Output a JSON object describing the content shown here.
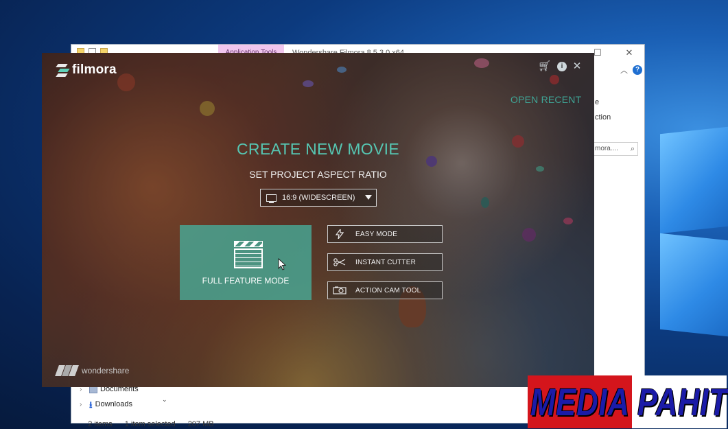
{
  "explorer": {
    "app_tools_tab": "Application Tools",
    "title": "Wondershare Filmora 8.5.3.0 x64",
    "ribbon_text_1": "e",
    "ribbon_text_2": "ction",
    "search_value": "mora....",
    "tree_items": [
      {
        "label": "Documents"
      },
      {
        "label": "Downloads"
      }
    ],
    "status": {
      "items": "2 items",
      "selected": "1 item selected",
      "size": "207 MB"
    }
  },
  "filmora": {
    "brand": "filmora",
    "open_recent": "OPEN RECENT",
    "create_title": "CREATE NEW MOVIE",
    "aspect_label": "SET PROJECT ASPECT RATIO",
    "aspect_value": "16:9  (WIDESCREEN)",
    "full_feature_label": "FULL FEATURE MODE",
    "modes": [
      {
        "label": "EASY MODE",
        "icon": "lightning-icon"
      },
      {
        "label": "INSTANT CUTTER",
        "icon": "scissors-icon"
      },
      {
        "label": "ACTION CAM TOOL",
        "icon": "camera-icon"
      }
    ],
    "footer_brand": "wondershare"
  },
  "watermark": {
    "text": "MEDIA PAHIT"
  },
  "colors": {
    "accent_teal": "#56c6b2",
    "full_feature_bg": "#48a896",
    "watermark_red": "#d4151c",
    "watermark_blue": "#1b1ba8"
  }
}
